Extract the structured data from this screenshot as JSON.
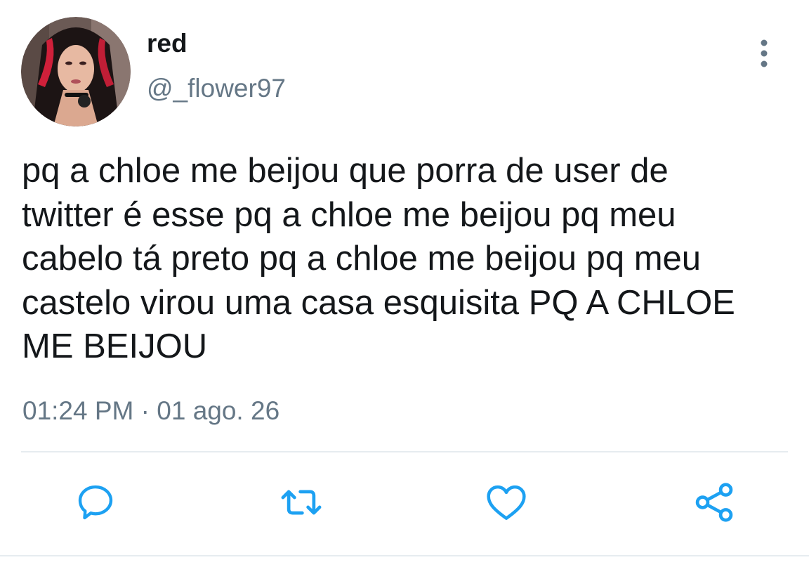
{
  "tweet": {
    "author": {
      "display_name": "red",
      "handle": "@_flower97"
    },
    "text": "pq a chloe me beijou que porra de user de\ntwitter é esse pq a chloe me beijou pq meu\ncabelo tá preto pq a chloe me beijou pq meu\ncastelo virou uma casa esquisita PQ A CHLOE\nME BEIJOU",
    "time": "01:24 PM",
    "separator": " · ",
    "date": "01 ago. 26"
  },
  "actions": {
    "icons": [
      "reply-icon",
      "retweet-icon",
      "like-icon",
      "share-icon"
    ]
  },
  "colors": {
    "text": "#14171a",
    "secondary": "#657786",
    "icon": "#1da1f2",
    "divider": "#e6ecf0"
  }
}
